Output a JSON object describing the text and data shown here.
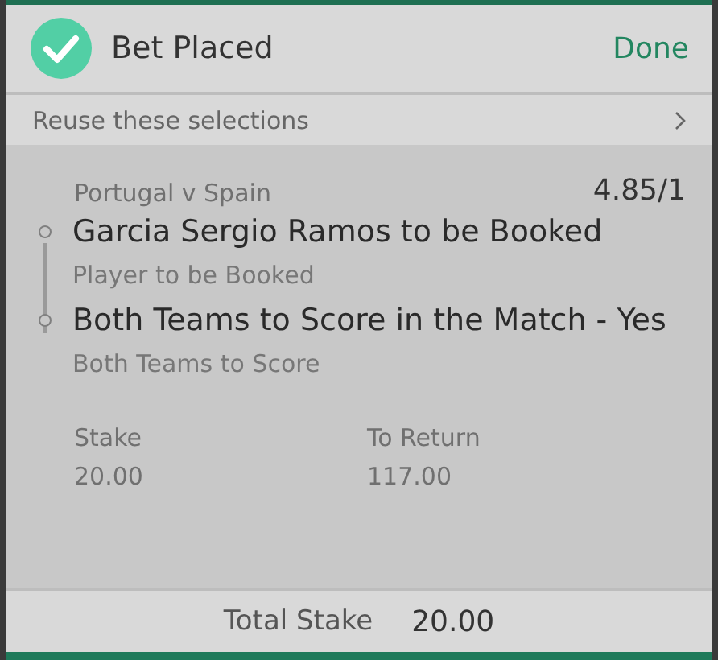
{
  "header": {
    "title": "Bet Placed",
    "done": "Done"
  },
  "reuse": {
    "label": "Reuse these selections"
  },
  "bet": {
    "event": "Portugal v Spain",
    "odds": "4.85/1",
    "selections": [
      {
        "name": "Garcia Sergio Ramos to be Booked",
        "market": "Player to be Booked"
      },
      {
        "name": "Both Teams to Score in the Match - Yes",
        "market": "Both Teams to Score"
      }
    ],
    "stake_label": "Stake",
    "stake": "20.00",
    "return_label": "To Return",
    "return": "117.00"
  },
  "footer": {
    "label": "Total Stake",
    "value": "20.00"
  }
}
